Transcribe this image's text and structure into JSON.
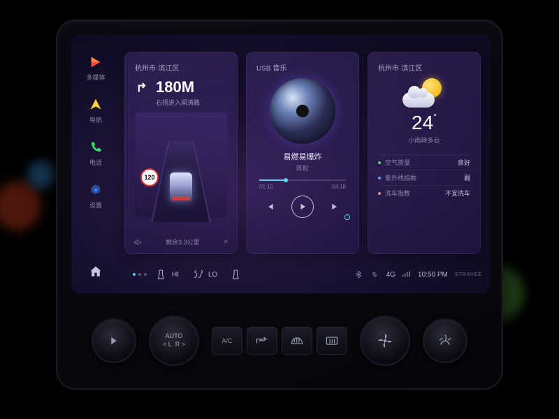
{
  "sidebar": {
    "items": [
      {
        "label": "多媒体"
      },
      {
        "label": "导航"
      },
      {
        "label": "电话"
      },
      {
        "label": "设置"
      }
    ]
  },
  "nav": {
    "location": "杭州市·滨江区",
    "distance": "180M",
    "street": "右拐进入闻涛路",
    "speed_limit": "120",
    "remaining": "剩余3.3公里"
  },
  "music": {
    "source": "USB 音乐",
    "title": "易燃易爆炸",
    "artist": "陈粒",
    "elapsed": "01:10",
    "total": "04:18"
  },
  "weather": {
    "location": "杭州市·滨江区",
    "temp": "24",
    "condition": "小雨转多云",
    "rows": [
      {
        "label": "空气质量",
        "value": "良好",
        "color": "#4fd66b"
      },
      {
        "label": "紫外线指数",
        "value": "弱",
        "color": "#5aa7ff"
      },
      {
        "label": "洗车指数",
        "value": "不宜洗车",
        "color": "#ff8a5a"
      }
    ]
  },
  "climate": {
    "left_temp": "HI",
    "right_temp": "LO"
  },
  "status": {
    "signal": "4G",
    "time": "10:50 PM",
    "brand": "STRAVEE"
  },
  "physical": {
    "dial_auto": "AUTO",
    "dial_l": "< L",
    "dial_r": "R >",
    "ac": "A/C"
  }
}
